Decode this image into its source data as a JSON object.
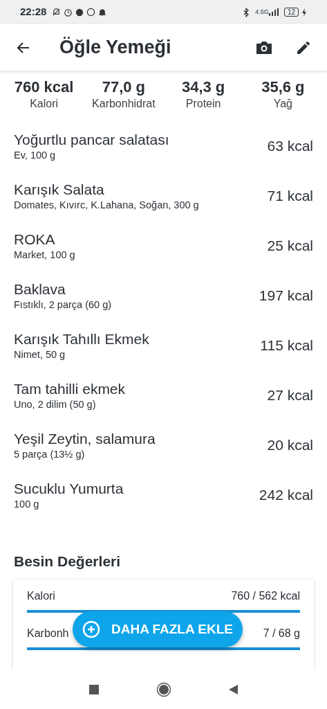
{
  "status_bar": {
    "time": "22:28",
    "network": "4.5G",
    "battery": "12"
  },
  "app_bar": {
    "title": "Öğle Yemeği"
  },
  "summary": [
    {
      "value": "760 kcal",
      "label": "Kalori"
    },
    {
      "value": "77,0 g",
      "label": "Karbonhidrat"
    },
    {
      "value": "34,3 g",
      "label": "Protein"
    },
    {
      "value": "35,6 g",
      "label": "Yağ"
    }
  ],
  "foods": [
    {
      "name": "Yoğurtlu pancar salatası",
      "detail": "Ev, 100 g",
      "calories": "63 kcal"
    },
    {
      "name": "Karışık Salata",
      "detail": "Domates, Kıvırc, K.Lahana, Soğan, 300 g",
      "calories": "71 kcal"
    },
    {
      "name": "ROKA",
      "detail": "Market, 100 g",
      "calories": "25 kcal"
    },
    {
      "name": "Baklava",
      "detail": "Fıstıklı, 2 parça (60 g)",
      "calories": "197 kcal"
    },
    {
      "name": "Karışık Tahıllı Ekmek",
      "detail": "Nimet, 50 g",
      "calories": "115 kcal"
    },
    {
      "name": "Tam tahilli ekmek",
      "detail": "Uno, 2 dilim (50 g)",
      "calories": "27 kcal"
    },
    {
      "name": "Yeşil Zeytin, salamura",
      "detail": "5 parça (13½ g)",
      "calories": "20 kcal"
    },
    {
      "name": "Sucuklu Yumurta",
      "detail": "100 g",
      "calories": "242 kcal"
    }
  ],
  "nutrition": {
    "title": "Besin Değerleri",
    "rows": [
      {
        "label": "Kalori",
        "value": "760 / 562 kcal",
        "level": 1
      },
      {
        "label": "Karbonh",
        "value": "7 / 68 g",
        "level": 1
      }
    ]
  },
  "fab": {
    "label": "DAHA FAZLA EKLE"
  }
}
